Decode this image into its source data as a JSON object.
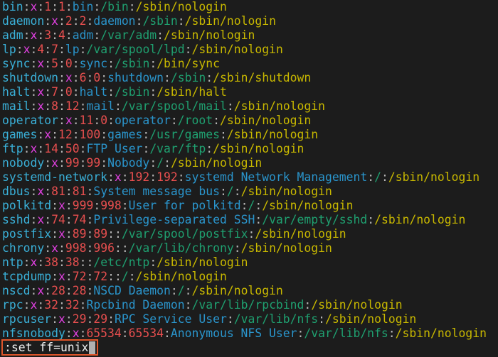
{
  "colors": {
    "user": "#3ab0d8",
    "password": "#e040e0",
    "ids": "#e84f4f",
    "gecos": "#2a95cc",
    "home": "#1fa070",
    "shell": "#c8b800",
    "highlight_border": "#e0552a"
  },
  "lines": [
    [
      "bin",
      "x",
      "1",
      "1",
      "bin",
      "/bin",
      "/sbin/nologin"
    ],
    [
      "daemon",
      "x",
      "2",
      "2",
      "daemon",
      "/sbin",
      "/sbin/nologin"
    ],
    [
      "adm",
      "x",
      "3",
      "4",
      "adm",
      "/var/adm",
      "/sbin/nologin"
    ],
    [
      "lp",
      "x",
      "4",
      "7",
      "lp",
      "/var/spool/lpd",
      "/sbin/nologin"
    ],
    [
      "sync",
      "x",
      "5",
      "0",
      "sync",
      "/sbin",
      "/bin/sync"
    ],
    [
      "shutdown",
      "x",
      "6",
      "0",
      "shutdown",
      "/sbin",
      "/sbin/shutdown"
    ],
    [
      "halt",
      "x",
      "7",
      "0",
      "halt",
      "/sbin",
      "/sbin/halt"
    ],
    [
      "mail",
      "x",
      "8",
      "12",
      "mail",
      "/var/spool/mail",
      "/sbin/nologin"
    ],
    [
      "operator",
      "x",
      "11",
      "0",
      "operator",
      "/root",
      "/sbin/nologin"
    ],
    [
      "games",
      "x",
      "12",
      "100",
      "games",
      "/usr/games",
      "/sbin/nologin"
    ],
    [
      "ftp",
      "x",
      "14",
      "50",
      "FTP User",
      "/var/ftp",
      "/sbin/nologin"
    ],
    [
      "nobody",
      "x",
      "99",
      "99",
      "Nobody",
      "/",
      "/sbin/nologin"
    ],
    [
      "systemd-network",
      "x",
      "192",
      "192",
      "systemd Network Management",
      "/",
      "/sbin/nologin"
    ],
    [
      "dbus",
      "x",
      "81",
      "81",
      "System message bus",
      "/",
      "/sbin/nologin"
    ],
    [
      "polkitd",
      "x",
      "999",
      "998",
      "User for polkitd",
      "/",
      "/sbin/nologin"
    ],
    [
      "sshd",
      "x",
      "74",
      "74",
      "Privilege-separated SSH",
      "/var/empty/sshd",
      "/sbin/nologin"
    ],
    [
      "postfix",
      "x",
      "89",
      "89",
      "",
      "/var/spool/postfix",
      "/sbin/nologin"
    ],
    [
      "chrony",
      "x",
      "998",
      "996",
      "",
      "/var/lib/chrony",
      "/sbin/nologin"
    ],
    [
      "ntp",
      "x",
      "38",
      "38",
      "",
      "/etc/ntp",
      "/sbin/nologin"
    ],
    [
      "tcpdump",
      "x",
      "72",
      "72",
      "",
      "/",
      "/sbin/nologin"
    ],
    [
      "nscd",
      "x",
      "28",
      "28",
      "NSCD Daemon",
      "/",
      "/sbin/nologin"
    ],
    [
      "rpc",
      "x",
      "32",
      "32",
      "Rpcbind Daemon",
      "/var/lib/rpcbind",
      "/sbin/nologin"
    ],
    [
      "rpcuser",
      "x",
      "29",
      "29",
      "RPC Service User",
      "/var/lib/nfs",
      "/sbin/nologin"
    ],
    [
      "nfsnobody",
      "x",
      "65534",
      "65534",
      "Anonymous NFS User",
      "/var/lib/nfs",
      "/sbin/nologin"
    ]
  ],
  "command_line": ":set ff=unix"
}
